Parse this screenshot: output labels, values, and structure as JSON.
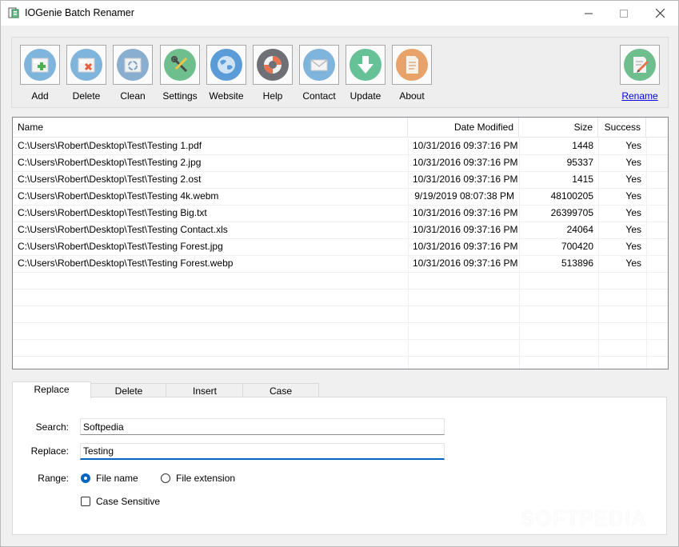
{
  "window": {
    "title": "IOGenie Batch Renamer"
  },
  "toolbar": {
    "buttons": [
      {
        "label": "Add",
        "icon": "add-file-icon",
        "color": "#7fb4dc"
      },
      {
        "label": "Delete",
        "icon": "delete-file-icon",
        "color": "#7fb4dc"
      },
      {
        "label": "Clean",
        "icon": "recycle-icon",
        "color": "#89aed0"
      },
      {
        "label": "Settings",
        "icon": "tools-icon",
        "color": "#6fbf8e"
      },
      {
        "label": "Website",
        "icon": "globe-icon",
        "color": "#5b9bd8"
      },
      {
        "label": "Help",
        "icon": "lifebuoy-icon",
        "color": "#6e7076"
      },
      {
        "label": "Contact",
        "icon": "envelope-icon",
        "color": "#7fb4dc"
      },
      {
        "label": "Update",
        "icon": "download-arrow-icon",
        "color": "#67c197"
      },
      {
        "label": "About",
        "icon": "document-icon",
        "color": "#e8a36a"
      }
    ],
    "rename": {
      "label": "Rename",
      "icon": "edit-document-icon",
      "color": "#6fbf8e"
    }
  },
  "filelist": {
    "columns": [
      "Name",
      "Date Modified",
      "Size",
      "Success"
    ],
    "rows": [
      {
        "name": "C:\\Users\\Robert\\Desktop\\Test\\Testing 1.pdf",
        "date": "10/31/2016 09:37:16 PM",
        "size": "1448",
        "success": "Yes"
      },
      {
        "name": "C:\\Users\\Robert\\Desktop\\Test\\Testing 2.jpg",
        "date": "10/31/2016 09:37:16 PM",
        "size": "95337",
        "success": "Yes"
      },
      {
        "name": "C:\\Users\\Robert\\Desktop\\Test\\Testing 2.ost",
        "date": "10/31/2016 09:37:16 PM",
        "size": "1415",
        "success": "Yes"
      },
      {
        "name": "C:\\Users\\Robert\\Desktop\\Test\\Testing 4k.webm",
        "date": "9/19/2019 08:07:38 PM",
        "size": "48100205",
        "success": "Yes"
      },
      {
        "name": "C:\\Users\\Robert\\Desktop\\Test\\Testing Big.txt",
        "date": "10/31/2016 09:37:16 PM",
        "size": "26399705",
        "success": "Yes"
      },
      {
        "name": "C:\\Users\\Robert\\Desktop\\Test\\Testing Contact.xls",
        "date": "10/31/2016 09:37:16 PM",
        "size": "24064",
        "success": "Yes"
      },
      {
        "name": "C:\\Users\\Robert\\Desktop\\Test\\Testing Forest.jpg",
        "date": "10/31/2016 09:37:16 PM",
        "size": "700420",
        "success": "Yes"
      },
      {
        "name": "C:\\Users\\Robert\\Desktop\\Test\\Testing Forest.webp",
        "date": "10/31/2016 09:37:16 PM",
        "size": "513896",
        "success": "Yes"
      }
    ]
  },
  "tabs": [
    {
      "label": "Replace",
      "active": true
    },
    {
      "label": "Delete",
      "active": false
    },
    {
      "label": "Insert",
      "active": false
    },
    {
      "label": "Case",
      "active": false
    }
  ],
  "replace": {
    "search_label": "Search:",
    "search_value": "Softpedia",
    "replace_label": "Replace:",
    "replace_value": "Testing",
    "range_label": "Range:",
    "range_options": [
      {
        "label": "File name",
        "checked": true
      },
      {
        "label": "File extension",
        "checked": false
      }
    ],
    "case_sensitive_label": "Case Sensitive",
    "case_sensitive_checked": false
  },
  "watermark": "SOFTPEDIA",
  "colors": {
    "accent": "#0067c0",
    "link": "#0000ee"
  }
}
